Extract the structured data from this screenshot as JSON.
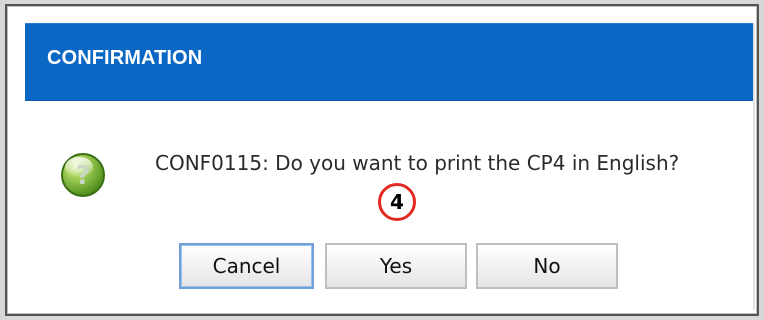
{
  "dialog": {
    "title": "CONFIRMATION",
    "message": "CONF0115: Do you want to print the CP4 in English?",
    "callout": "4",
    "buttons": {
      "cancel": "Cancel",
      "yes": "Yes",
      "no": "No"
    },
    "icon": {
      "name": "question-icon",
      "color": "#7bb33a"
    },
    "colors": {
      "title_bar": "#0a67c3",
      "title_text": "#ffffff",
      "callout_ring": "#e32a22"
    }
  }
}
